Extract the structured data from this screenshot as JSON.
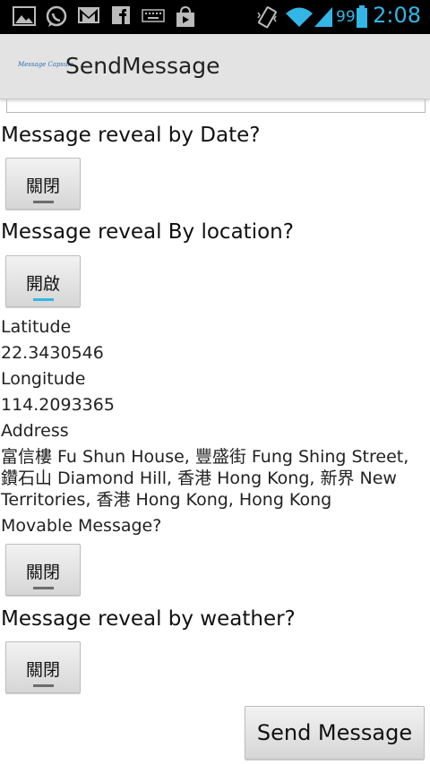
{
  "status_bar": {
    "icons": [
      "gallery-icon",
      "whatsapp-icon",
      "gmail-icon",
      "facebook-icon",
      "keyboard-icon",
      "play-store-icon",
      "vibrate-icon",
      "wifi-icon",
      "signal-icon",
      "battery-icon"
    ],
    "battery_level": "99",
    "time": "2:08",
    "accent_color": "#33b5e5"
  },
  "action_bar": {
    "logo_text": "Message Capsule",
    "title": "SendMessage"
  },
  "form": {
    "date_heading": "Message reveal by Date?",
    "date_toggle": "關閉",
    "location_heading": "Message reveal By location?",
    "location_toggle": "開啟",
    "latitude_label": "Latitude",
    "latitude_value": "22.3430546",
    "longitude_label": "Longitude",
    "longitude_value": "114.2093365",
    "address_label": "Address",
    "address_value": "富信樓 Fu Shun House, 豐盛街 Fung Shing Street, 鑽石山 Diamond Hill, 香港 Hong Kong, 新界 New Territories, 香港 Hong Kong, Hong Kong",
    "movable_label": "Movable Message?",
    "movable_toggle": "關閉",
    "weather_heading": "Message reveal by weather?",
    "weather_toggle": "關閉",
    "send_button": "Send Message"
  }
}
